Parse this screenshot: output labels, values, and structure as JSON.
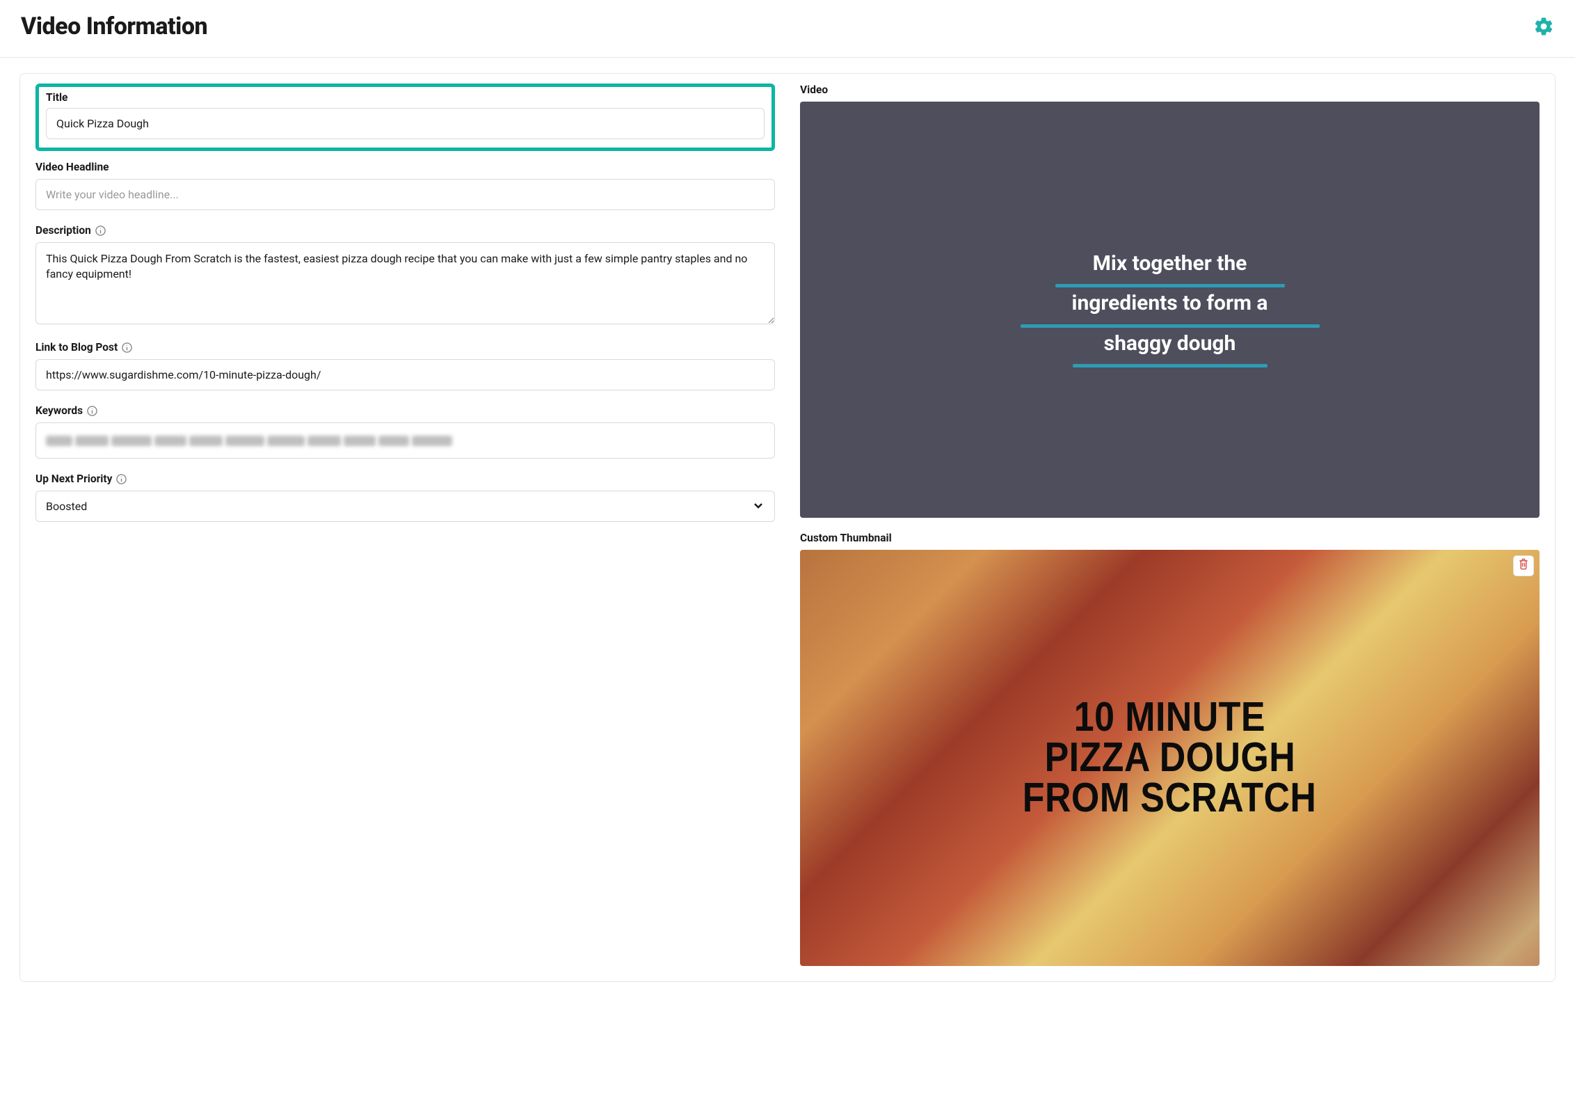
{
  "header": {
    "title": "Video Information"
  },
  "form": {
    "title": {
      "label": "Title",
      "value": "Quick Pizza Dough"
    },
    "headline": {
      "label": "Video Headline",
      "placeholder": "Write your video headline...",
      "value": ""
    },
    "description": {
      "label": "Description",
      "value": "This Quick Pizza Dough From Scratch is the fastest, easiest pizza dough recipe that you can make with just a few simple pantry staples and no fancy equipment!"
    },
    "link": {
      "label": "Link to Blog Post",
      "value": "https://www.sugardishme.com/10-minute-pizza-dough/"
    },
    "keywords": {
      "label": "Keywords"
    },
    "priority": {
      "label": "Up Next Priority",
      "value": "Boosted"
    }
  },
  "video": {
    "label": "Video",
    "caption_line1": "Mix together the",
    "caption_line2": "ingredients to form a",
    "caption_line3": "shaggy dough"
  },
  "thumbnail": {
    "label": "Custom Thumbnail",
    "overlay_line1": "10 MINUTE",
    "overlay_line2": "PIZZA DOUGH",
    "overlay_line3": "FROM SCRATCH"
  }
}
